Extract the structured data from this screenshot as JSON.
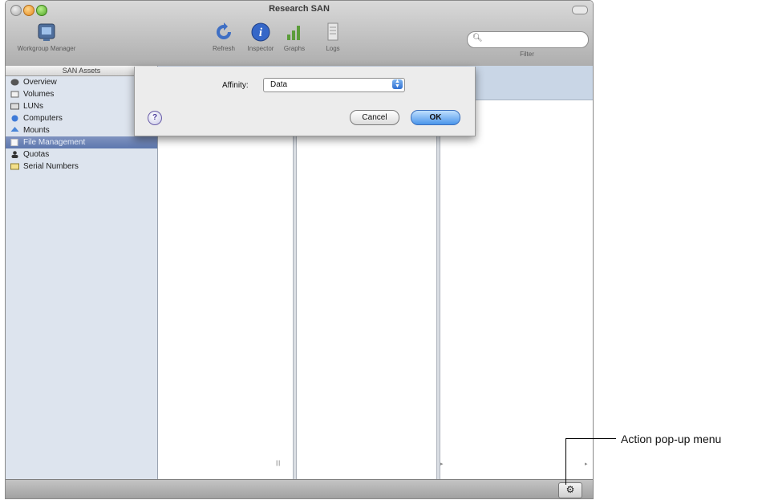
{
  "window": {
    "title": "Research SAN"
  },
  "toolbar": {
    "items": [
      {
        "label": "Workgroup Manager",
        "icon": "workgroup-manager-icon"
      },
      {
        "label": "Refresh",
        "icon": "refresh-icon"
      },
      {
        "label": "Inspector",
        "icon": "inspector-icon"
      },
      {
        "label": "Graphs",
        "icon": "graphs-icon"
      },
      {
        "label": "Logs",
        "icon": "logs-icon"
      }
    ],
    "search_placeholder": "",
    "filter_label": "Filter"
  },
  "sidebar": {
    "header": "SAN Assets",
    "items": [
      {
        "label": "Overview",
        "icon": "overview-icon"
      },
      {
        "label": "Volumes",
        "icon": "volumes-icon"
      },
      {
        "label": "LUNs",
        "icon": "luns-icon"
      },
      {
        "label": "Computers",
        "icon": "computers-icon"
      },
      {
        "label": "Mounts",
        "icon": "mounts-icon"
      },
      {
        "label": "File Management",
        "icon": "file-management-icon",
        "selected": true
      },
      {
        "label": "Quotas",
        "icon": "quotas-icon"
      },
      {
        "label": "Serial Numbers",
        "icon": "serial-numbers-icon"
      }
    ]
  },
  "sheet": {
    "affinity_label": "Affinity:",
    "affinity_value": "Data",
    "help_symbol": "?",
    "cancel_label": "Cancel",
    "ok_label": "OK"
  },
  "bottom": {
    "action_symbol": "⚙"
  },
  "callout": {
    "label": "Action pop-up menu"
  },
  "colors": {
    "accent": "#4a95ea",
    "selection": "#5d77ae",
    "sidebar_bg": "#dde4ee"
  }
}
